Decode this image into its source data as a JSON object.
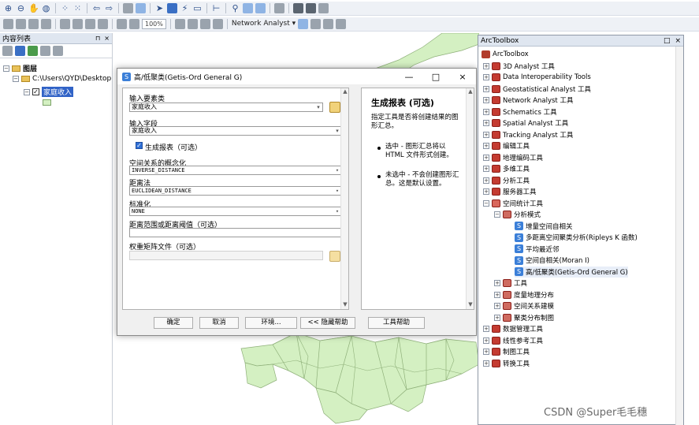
{
  "toolbar": {
    "map_scale": "100%",
    "network_analyst": "Network Analyst ▾"
  },
  "toc": {
    "title": "内容列表",
    "pin": "⊓",
    "close": "×",
    "root": "图层",
    "path": "C:\\Users\\QYD\\Desktop",
    "layer": "家庭收入"
  },
  "dialog": {
    "title": "高/低聚类(Getis-Ord General G)",
    "minimize": "—",
    "maximize": "□",
    "close": "×",
    "input_features_label": "输入要素类",
    "input_features_value": "家庭收入",
    "input_field_label": "输入字段",
    "input_field_value": "家庭收入",
    "report_label": "生成报表（可选）",
    "conceptualization_label": "空间关系的概念化",
    "conceptualization_value": "INVERSE_DISTANCE",
    "distance_method_label": "距离法",
    "distance_method_value": "EUCLIDEAN_DISTANCE",
    "standardization_label": "标准化",
    "standardization_value": "NONE",
    "distance_threshold_label": "距离范围或距离阈值（可选）",
    "weights_file_label": "权重矩阵文件（可选）",
    "help_title": "生成报表 (可选)",
    "help_intro": "指定工具是否将创建结果的图形汇总。",
    "help_item1": "选中 - 图形汇总将以 HTML 文件形式创建。",
    "help_item2": "未选中 - 不会创建图形汇总。这是默认设置。",
    "buttons": {
      "ok": "确定",
      "cancel": "取消",
      "env": "环境...",
      "hide_help": "<< 隐藏帮助",
      "tool_help": "工具帮助"
    }
  },
  "arctoolbox": {
    "title": "ArcToolbox",
    "close": "×",
    "root": "ArcToolbox",
    "toolboxes": [
      "3D Analyst 工具",
      "Data Interoperability Tools",
      "Geostatistical Analyst 工具",
      "Network Analyst 工具",
      "Schematics 工具",
      "Spatial Analyst 工具",
      "Tracking Analyst 工具",
      "编辑工具",
      "地理编码工具",
      "多维工具",
      "分析工具",
      "服务器工具",
      "空间统计工具"
    ],
    "toolset_open": "分析模式",
    "tools": [
      "增量空间自相关",
      "多距离空间聚类分析(Ripleys K 函数)",
      "平均最近邻",
      "空间自相关(Moran I)",
      "高/低聚类(Getis-Ord General G)"
    ],
    "other_toolsets": [
      "工具",
      "度量地理分布",
      "空间关系建模",
      "聚类分布制图"
    ],
    "after": [
      "数据管理工具",
      "线性参考工具",
      "制图工具",
      "转换工具"
    ]
  },
  "watermark": "CSDN @Super毛毛穗",
  "colors": {
    "map_fill": "#d4f0c2",
    "selection": "#3163c7",
    "toolbox_red": "#c43b31"
  }
}
